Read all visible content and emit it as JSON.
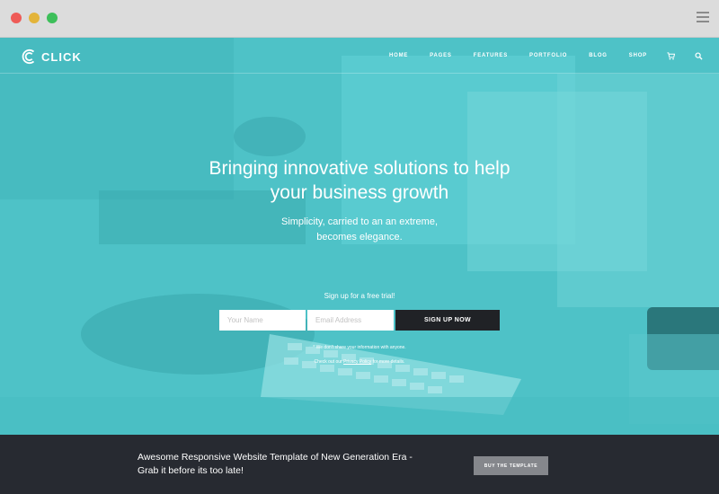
{
  "colors": {
    "hero_tint": "#4fc3c8",
    "footer_bg": "#272a31",
    "button_dark": "#202226",
    "button_gray": "#85878c"
  },
  "brand": {
    "name": "CLICK",
    "logo_icon": "c-logo-icon"
  },
  "nav": {
    "items": [
      "HOME",
      "PAGES",
      "FEATURES",
      "PORTFOLIO",
      "BLOG",
      "SHOP"
    ],
    "icons": [
      "cart-icon",
      "search-icon"
    ]
  },
  "hero": {
    "headline_line1": "Bringing innovative solutions to help",
    "headline_line2": "your business growth",
    "subline_line1": "Simplicity, carried to an an extreme,",
    "subline_line2": "becomes elegance.",
    "signup_label": "Sign up for a free trial!",
    "name_placeholder": "Your Name",
    "email_placeholder": "Email Address",
    "signup_button": "SIGN UP NOW",
    "note1": "* We don't share your information with anyone.",
    "note2_prefix": "Check out our",
    "note2_link": "Privacy Policy",
    "note2_suffix": "for more details."
  },
  "footer": {
    "line1": "Awesome Responsive Website Template of New Generation Era -",
    "line2": "Grab it before its too late!",
    "button": "BUY THE TEMPLATE"
  }
}
